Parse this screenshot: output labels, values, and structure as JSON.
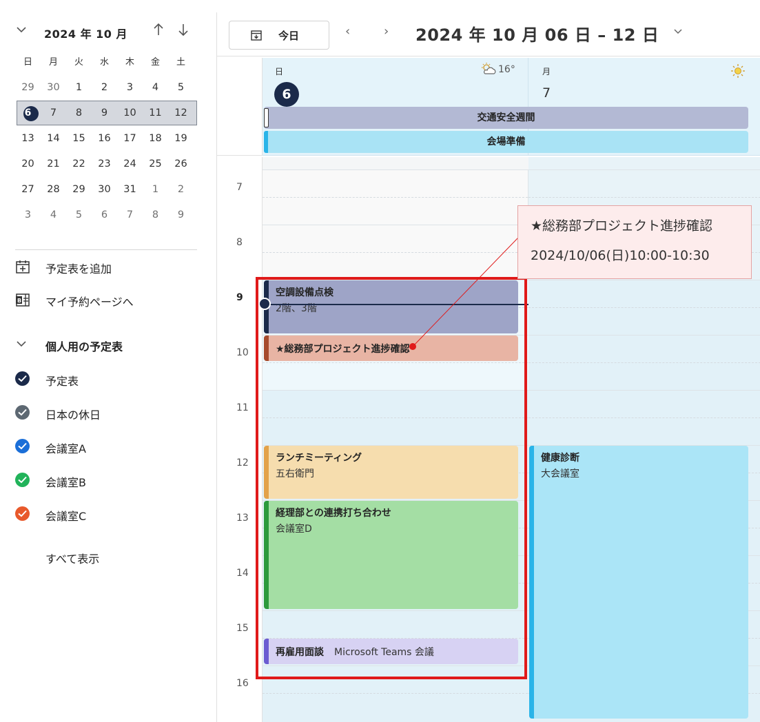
{
  "mini_calendar": {
    "title": "2024 年 10 月",
    "weekdays": [
      "日",
      "月",
      "火",
      "水",
      "木",
      "金",
      "土"
    ],
    "weeks": [
      [
        "29",
        "30",
        "1",
        "2",
        "3",
        "4",
        "5"
      ],
      [
        "6",
        "7",
        "8",
        "9",
        "10",
        "11",
        "12"
      ],
      [
        "13",
        "14",
        "15",
        "16",
        "17",
        "18",
        "19"
      ],
      [
        "20",
        "21",
        "22",
        "23",
        "24",
        "25",
        "26"
      ],
      [
        "27",
        "28",
        "29",
        "30",
        "31",
        "1",
        "2"
      ],
      [
        "3",
        "4",
        "5",
        "6",
        "7",
        "8",
        "9"
      ]
    ],
    "dim_cells": [
      "0-0",
      "0-1",
      "4-5",
      "4-6",
      "5-0",
      "5-1",
      "5-2",
      "5-3",
      "5-4",
      "5-5",
      "5-6"
    ],
    "today": "6",
    "icons": {
      "collapse": "chevron-down-icon",
      "prev": "arrow-up-icon",
      "next": "arrow-down-icon"
    }
  },
  "actions": {
    "add_calendar": "予定表を追加",
    "booking_page": "マイ予約ページへ"
  },
  "personal_calendars": {
    "title": "個人用の予定表",
    "items": [
      {
        "label": "予定表",
        "color": "#1b2a4a"
      },
      {
        "label": "日本の休日",
        "color": "#5d6872"
      },
      {
        "label": "会議室A",
        "color": "#1b6fd8"
      },
      {
        "label": "会議室B",
        "color": "#21b35a"
      },
      {
        "label": "会議室C",
        "color": "#e8592b"
      }
    ],
    "show_all": "すべて表示"
  },
  "toolbar": {
    "today_label": "今日",
    "prev": "‹",
    "next": "›",
    "range": "2024 年 10 月 06 日 – 12 日"
  },
  "days": [
    {
      "name": "日",
      "date": "6",
      "weather": "16°",
      "weather_icon": "partly-cloudy-icon"
    },
    {
      "name": "月",
      "date": "7",
      "weather_icon": "sun-icon"
    }
  ],
  "all_day_events": [
    {
      "title": "交通安全週間",
      "color": "#b3b9d4"
    },
    {
      "title": "会場準備",
      "color": "#a9e3f5",
      "bar": "#2ab4e8"
    }
  ],
  "hours": [
    "7",
    "8",
    "9",
    "10",
    "11",
    "12",
    "13",
    "14",
    "15",
    "16"
  ],
  "current_hour": "9",
  "events": [
    {
      "title": "空調設備点検",
      "sub": "2階、3階",
      "bg": "#9ea4c7",
      "bar": "#1b2a4a"
    },
    {
      "title": "★総務部プロジェクト進捗確認",
      "sub": "",
      "bg": "#e8b4a4",
      "bar": "#a64b2d"
    },
    {
      "title": "ランチミーティング",
      "sub": "五右衛門",
      "bg": "#f6ddae",
      "bar": "#e3a24a"
    },
    {
      "title": "経理部との連携打ち合わせ",
      "sub": "会議室D",
      "bg": "#a4dea4",
      "bar": "#2c9a3c"
    },
    {
      "title": "再雇用面談",
      "sub": "Microsoft Teams 会議",
      "bg": "#d7d2f3",
      "bar": "#6b5cd1"
    },
    {
      "title": "健康診断",
      "sub": "大会議室",
      "bg": "#abe5f7",
      "bar": "#2ab4e8"
    }
  ],
  "callout": {
    "line1": "★総務部プロジェクト進捗確認",
    "line2": "2024/10/06(日)10:00-10:30"
  }
}
